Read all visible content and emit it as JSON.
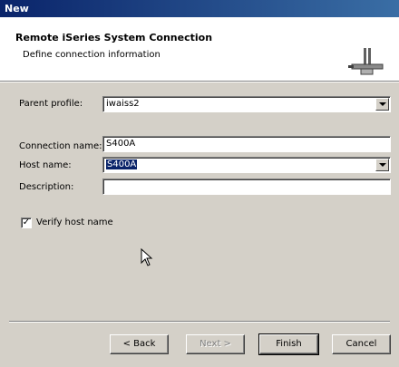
{
  "window": {
    "title": "New"
  },
  "header": {
    "title": "Remote iSeries System Connection",
    "description": "Define connection information",
    "icon": "connection-plug-icon"
  },
  "form": {
    "parent_profile": {
      "label": "Parent profile:",
      "value": "iwaiss2"
    },
    "connection_name": {
      "label": "Connection name:",
      "value": "S400A"
    },
    "host_name": {
      "label": "Host name:",
      "value": "S400A"
    },
    "description": {
      "label": "Description:",
      "value": ""
    },
    "verify_host_name": {
      "label": "Verify host name",
      "checked": true
    }
  },
  "buttons": {
    "back": "< Back",
    "next": "Next >",
    "finish": "Finish",
    "cancel": "Cancel"
  },
  "colors": {
    "title_bar": "#0a246a",
    "selection": "#0a246a",
    "dialog_bg": "#d4d0c8"
  }
}
